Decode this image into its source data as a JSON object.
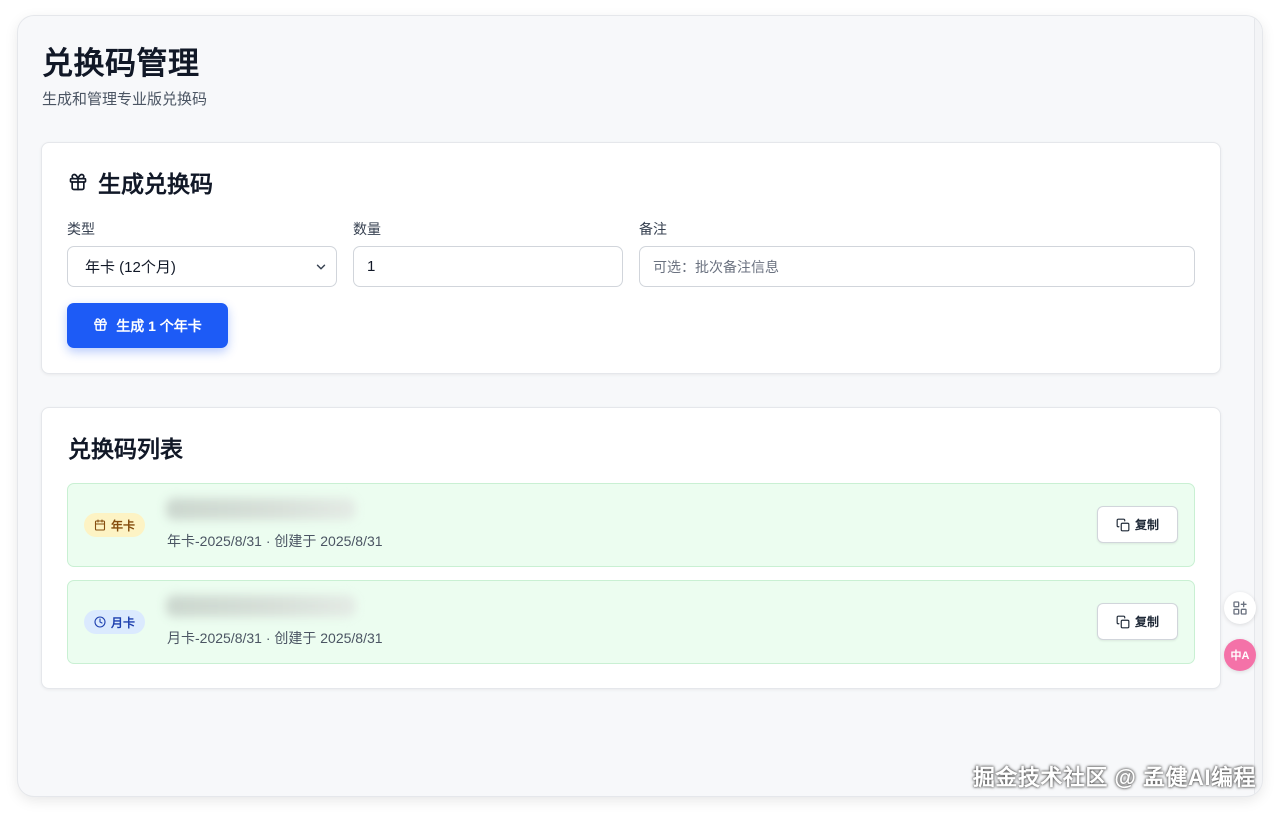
{
  "page": {
    "title": "兑换码管理",
    "subtitle": "生成和管理专业版兑换码"
  },
  "generate": {
    "title": "生成兑换码",
    "type_label": "类型",
    "type_value": "年卡 (12个月)",
    "quantity_label": "数量",
    "quantity_value": "1",
    "note_label": "备注",
    "note_placeholder": "可选：批次备注信息",
    "button_label": "生成 1 个年卡"
  },
  "list": {
    "title": "兑换码列表",
    "items": [
      {
        "badge": "年卡",
        "badge_icon": "calendar-icon",
        "meta": "年卡-2025/8/31 · 创建于 2025/8/31",
        "copy_label": "复制"
      },
      {
        "badge": "月卡",
        "badge_icon": "clock-icon",
        "meta": "月卡-2025/8/31 · 创建于 2025/8/31",
        "copy_label": "复制"
      }
    ]
  },
  "side_tools": {
    "translate_label": "中A"
  },
  "watermark": "掘金技术社区 @ 孟健AI编程",
  "colors": {
    "primary": "#1d5bf6",
    "row_bg": "#ecfdf0",
    "badge_yearly_bg": "#fdf3c4",
    "badge_monthly_bg": "#dbeafe"
  }
}
